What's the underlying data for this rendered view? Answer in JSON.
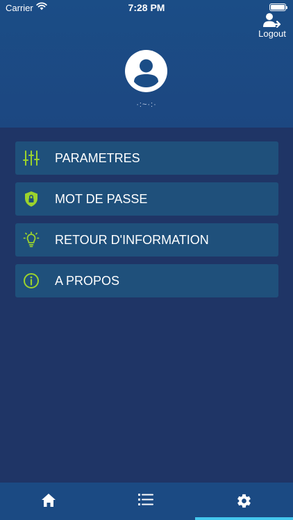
{
  "status_bar": {
    "carrier": "Carrier",
    "time": "7:28 PM"
  },
  "header": {
    "logout_label": "Logout",
    "username": "·:~·:·",
    "logout_icon": "user-logout-icon",
    "avatar_icon": "user-avatar-icon"
  },
  "menu": {
    "items": [
      {
        "label": "PARAMETRES",
        "icon": "sliders-icon"
      },
      {
        "label": "MOT DE PASSE",
        "icon": "shield-lock-icon"
      },
      {
        "label": "RETOUR D'INFORMATION",
        "icon": "lightbulb-icon"
      },
      {
        "label": "A PROPOS",
        "icon": "info-icon"
      }
    ]
  },
  "tabbar": {
    "tabs": [
      {
        "name": "home",
        "icon": "home-icon"
      },
      {
        "name": "list",
        "icon": "list-icon"
      },
      {
        "name": "settings",
        "icon": "gear-icon",
        "selected": true
      }
    ]
  },
  "colors": {
    "header_bg": "#1b4d86",
    "page_bg": "#1f3566",
    "menu_item_bg": "#1f507b",
    "icon_accent": "#9bd32d",
    "tab_indicator": "#43c7ee"
  }
}
